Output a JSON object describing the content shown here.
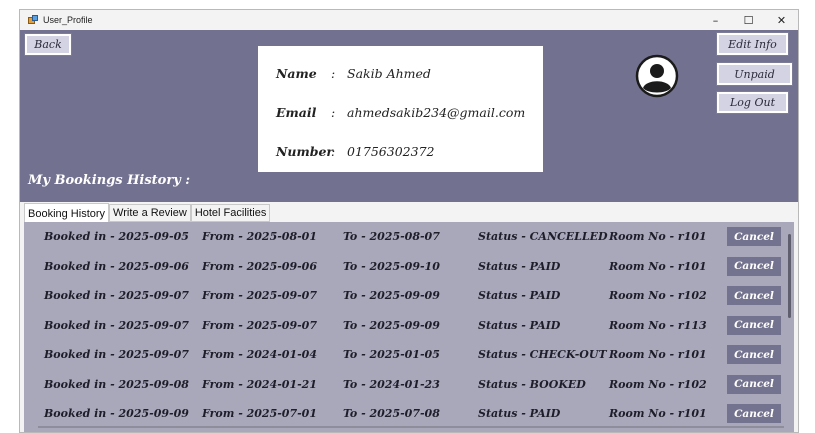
{
  "window": {
    "title": "User_Profile",
    "min_glyph": "–",
    "max_glyph": "☐",
    "close_glyph": "✕"
  },
  "header": {
    "back_label": "Back",
    "edit_label": "Edit Info",
    "unpaid_label": "Unpaid",
    "logout_label": "Log Out",
    "history_title": "My Bookings History :"
  },
  "profile": {
    "name_label": "Name",
    "email_label": "Email",
    "number_label": "Number",
    "sep": ":",
    "name": "Sakib Ahmed",
    "email": "ahmedsakib234@gmail.com",
    "number": "01756302372"
  },
  "tabs": [
    {
      "label": "Booking History"
    },
    {
      "label": "Write a Review"
    },
    {
      "label": "Hotel Facilities"
    }
  ],
  "bookings": [
    {
      "booked": "Booked in - 2025-09-05",
      "from": "From - 2025-08-01",
      "to": "To - 2025-08-07",
      "status": "Status - CANCELLED",
      "room": "Room No - r101",
      "action": "Cancel"
    },
    {
      "booked": "Booked in - 2025-09-06",
      "from": "From - 2025-09-06",
      "to": "To - 2025-09-10",
      "status": "Status - PAID",
      "room": "Room No - r101",
      "action": "Cancel"
    },
    {
      "booked": "Booked in - 2025-09-07",
      "from": "From - 2025-09-07",
      "to": "To - 2025-09-09",
      "status": "Status - PAID",
      "room": "Room No - r102",
      "action": "Cancel"
    },
    {
      "booked": "Booked in - 2025-09-07",
      "from": "From - 2025-09-07",
      "to": "To - 2025-09-09",
      "status": "Status - PAID",
      "room": "Room No - r113",
      "action": "Cancel"
    },
    {
      "booked": "Booked in - 2025-09-07",
      "from": "From - 2024-01-04",
      "to": "To - 2025-01-05",
      "status": "Status - CHECK-OUT",
      "room": "Room No - r101",
      "action": "Cancel"
    },
    {
      "booked": "Booked in - 2025-09-08",
      "from": "From - 2024-01-21",
      "to": "To - 2024-01-23",
      "status": "Status - BOOKED",
      "room": "Room No - r102",
      "action": "Cancel"
    },
    {
      "booked": "Booked in - 2025-09-09",
      "from": "From - 2025-07-01",
      "to": "To - 2025-07-08",
      "status": "Status - PAID",
      "room": "Room No - r101",
      "action": "Cancel"
    }
  ],
  "colors": {
    "header_bg": "#72718f",
    "list_bg": "#a9a8bb",
    "cancel_bg": "#74738f"
  }
}
